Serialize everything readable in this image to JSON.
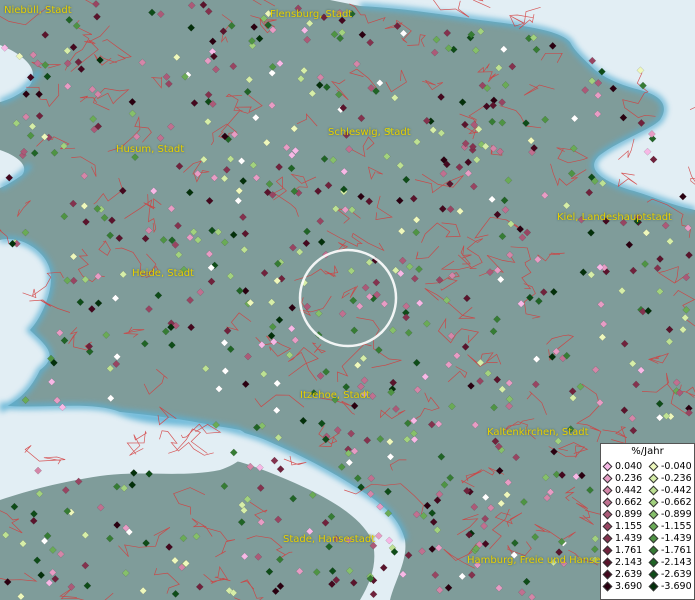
{
  "cities": [
    {
      "id": "niebull",
      "label": "Niebüll, Stadt"
    },
    {
      "id": "flensburg",
      "label": "Flensburg, Stadt"
    },
    {
      "id": "husum",
      "label": "Husum, Stadt"
    },
    {
      "id": "schleswig",
      "label": "Schleswig, Stadt"
    },
    {
      "id": "kiel",
      "label": "Kiel, Landeshauptstadt"
    },
    {
      "id": "heide",
      "label": "Heide, Stadt"
    },
    {
      "id": "itzehoe",
      "label": "Itzehoe, Stadt"
    },
    {
      "id": "kaltenkirchen",
      "label": "Kaltenkirchen, Stadt"
    },
    {
      "id": "stade",
      "label": "Stade, Hansestadt"
    },
    {
      "id": "hamburg",
      "label": "Hamburg, Freie und Hanse"
    }
  ],
  "legend": {
    "title": "%/Jahr",
    "positive": [
      {
        "label": "0.040",
        "color": "#f7b8e6"
      },
      {
        "label": "0.236",
        "color": "#e79cc4"
      },
      {
        "label": "0.442",
        "color": "#d486a8"
      },
      {
        "label": "0.662",
        "color": "#c07090"
      },
      {
        "label": "0.899",
        "color": "#ac5a78"
      },
      {
        "label": "1.155",
        "color": "#984562"
      },
      {
        "label": "1.439",
        "color": "#84324e"
      },
      {
        "label": "1.761",
        "color": "#70223c"
      },
      {
        "label": "2.143",
        "color": "#5a142c"
      },
      {
        "label": "2.639",
        "color": "#44081e"
      },
      {
        "label": "3.690",
        "color": "#2a0010"
      }
    ],
    "negative": [
      {
        "label": "-0.040",
        "color": "#eef8bc"
      },
      {
        "label": "-0.236",
        "color": "#d6eea8"
      },
      {
        "label": "-0.442",
        "color": "#bde193"
      },
      {
        "label": "-0.662",
        "color": "#a2d27e"
      },
      {
        "label": "-0.899",
        "color": "#86c06a"
      },
      {
        "label": "-1.155",
        "color": "#6aab56"
      },
      {
        "label": "-1.439",
        "color": "#4f9444"
      },
      {
        "label": "-1.761",
        "color": "#367c34"
      },
      {
        "label": "-2.143",
        "color": "#206426"
      },
      {
        "label": "-2.639",
        "color": "#0e4c18"
      },
      {
        "label": "-3.690",
        "color": "#03300a"
      }
    ]
  },
  "colors": {
    "land": "#7f9c9a",
    "sea": "#e2eef4",
    "coast_glow": "#5ab0d4",
    "boundary": "#d43c3c",
    "city_label": "#e8d000",
    "white_point": "#ffffff"
  },
  "selection_marker": "circle-icon"
}
